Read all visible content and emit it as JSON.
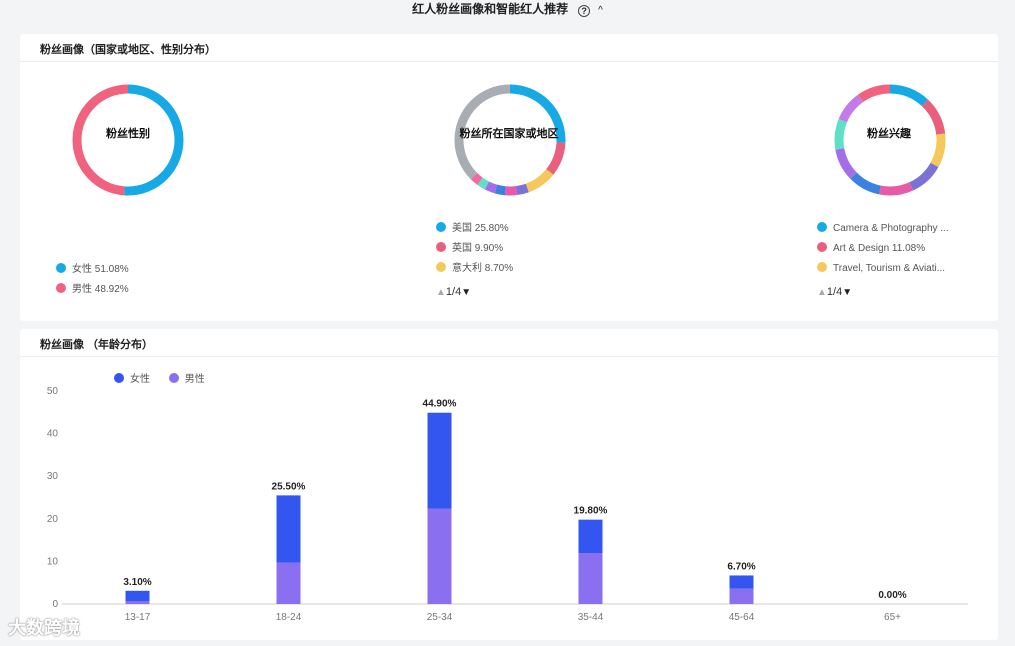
{
  "header": {
    "title": "红人粉丝画像和智能红人推荐",
    "help_icon": "?",
    "collapse_icon": "^"
  },
  "card1": {
    "title": "粉丝画像（国家或地区、性别分布）"
  },
  "card2": {
    "title": "粉丝画像 （年龄分布）"
  },
  "gender": {
    "label": "粉丝性别",
    "slices": [
      {
        "name": "女性",
        "value": 51.08,
        "pct_label": "51.08%",
        "color": "#17a9e6"
      },
      {
        "name": "男性",
        "value": 48.92,
        "pct_label": "48.92%",
        "color": "#f0627e"
      }
    ]
  },
  "country": {
    "label": "粉丝所在国家或地区",
    "legend": [
      {
        "name": "美国",
        "pct_label": "25.80%",
        "color": "#17a9e6"
      },
      {
        "name": "英国",
        "pct_label": "9.90%",
        "color": "#e8607b"
      },
      {
        "name": "意大利",
        "pct_label": "8.70%",
        "color": "#f5c85e"
      }
    ],
    "slices": [
      {
        "value": 25.8,
        "color": "#17a9e6"
      },
      {
        "value": 9.9,
        "color": "#e8607b"
      },
      {
        "value": 8.7,
        "color": "#f5c85e"
      },
      {
        "value": 3.5,
        "color": "#7b72d6"
      },
      {
        "value": 3.5,
        "color": "#e65aa8"
      },
      {
        "value": 3.0,
        "color": "#3b82e0"
      },
      {
        "value": 3.0,
        "color": "#a36ee8"
      },
      {
        "value": 2.5,
        "color": "#5ee0c8"
      },
      {
        "value": 2.5,
        "color": "#ef6aa0"
      },
      {
        "value": 37.6,
        "color": "#a8adb4"
      }
    ],
    "pager": {
      "text": "1/4",
      "up": "▲",
      "down": "▼"
    }
  },
  "interest": {
    "label": "粉丝兴趣",
    "legend": [
      {
        "name": "Camera & Photography ...",
        "color": "#17a9e6"
      },
      {
        "name": "Art & Design 11.08%",
        "color": "#e8607b"
      },
      {
        "name": "Travel, Tourism & Aviati...",
        "color": "#f5c85e"
      }
    ],
    "slices": [
      {
        "value": 12.0,
        "color": "#17a9e6"
      },
      {
        "value": 11.08,
        "color": "#e8607b"
      },
      {
        "value": 10.0,
        "color": "#f5c85e"
      },
      {
        "value": 10.0,
        "color": "#7b72d6"
      },
      {
        "value": 10.0,
        "color": "#e65aa8"
      },
      {
        "value": 9.5,
        "color": "#3b82e0"
      },
      {
        "value": 9.5,
        "color": "#a36ee8"
      },
      {
        "value": 9.0,
        "color": "#5ee0c8"
      },
      {
        "value": 9.0,
        "color": "#c47be8"
      },
      {
        "value": 9.92,
        "color": "#f0627e"
      }
    ],
    "pager": {
      "text": "1/4",
      "up": "▲",
      "down": "▼"
    }
  },
  "chart_data": {
    "type": "bar",
    "stacked": true,
    "categories": [
      "13-17",
      "18-24",
      "25-34",
      "35-44",
      "45-64",
      "65+"
    ],
    "series": [
      {
        "name": "女性",
        "color": "#3355f0",
        "values": [
          2.4,
          15.8,
          22.5,
          7.9,
          3.1,
          0
        ]
      },
      {
        "name": "男性",
        "color": "#8a6ff0",
        "values": [
          0.7,
          9.7,
          22.4,
          11.9,
          3.6,
          0
        ]
      }
    ],
    "totals": [
      "3.10%",
      "25.50%",
      "44.90%",
      "19.80%",
      "6.70%",
      "0.00%"
    ],
    "yticks": [
      "0",
      "10",
      "20",
      "30",
      "40",
      "50"
    ],
    "ylim": [
      0,
      50
    ],
    "grid": false,
    "legend": "top-left"
  },
  "watermark": {
    "text": "大数跨境"
  }
}
